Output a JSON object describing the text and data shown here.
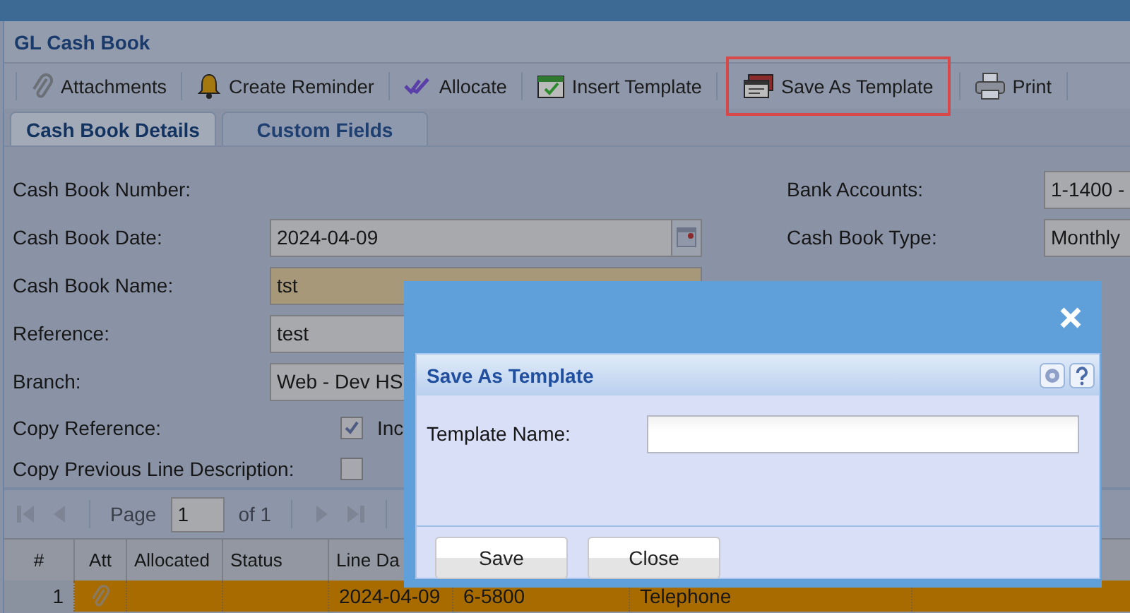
{
  "window": {
    "title": "GL Cash Book"
  },
  "toolbar": [
    {
      "kind": "attachments",
      "label": "Attachments",
      "highlighted": false
    },
    {
      "kind": "reminder",
      "label": "Create Reminder",
      "highlighted": false
    },
    {
      "kind": "allocate",
      "label": "Allocate",
      "highlighted": false
    },
    {
      "kind": "insert",
      "label": "Insert Template",
      "highlighted": false
    },
    {
      "kind": "save-template",
      "label": "Save As Template",
      "highlighted": true
    },
    {
      "kind": "print",
      "label": "Print",
      "highlighted": false
    }
  ],
  "tabs": [
    {
      "label": "Cash Book Details",
      "selected": true
    },
    {
      "label": "Custom Fields",
      "selected": false
    }
  ],
  "form_left": [
    {
      "kind": "label",
      "label": "Cash Book Number:"
    },
    {
      "kind": "date",
      "label": "Cash Book Date:",
      "value": "2024-04-09"
    },
    {
      "kind": "text",
      "label": "Cash Book Name:",
      "value": "tst",
      "required": true
    },
    {
      "kind": "text",
      "label": "Reference:",
      "value": "test",
      "required": false
    },
    {
      "kind": "text",
      "label": "Branch:",
      "value": "Web - Dev HS",
      "required": false
    },
    {
      "kind": "checkbox",
      "label": "Copy Reference:",
      "checked": true,
      "option": "Inc"
    },
    {
      "kind": "checkbox",
      "label": "Copy Previous Line Description:",
      "checked": false
    }
  ],
  "form_right": [
    {
      "label": "Bank Accounts:",
      "value": "1-1400 -"
    },
    {
      "label": "Cash Book Type:",
      "value": "Monthly"
    }
  ],
  "pager": {
    "page_label": "Page",
    "page": "1",
    "of": "of 1"
  },
  "grid": {
    "columns": [
      "#",
      "Att",
      "Allocated",
      "Status",
      "Line Da"
    ],
    "rows": [
      {
        "number": "1",
        "has_attachment": true,
        "line_date": "2024-04-09",
        "column_6": "6-5800",
        "column_7": "Telephone",
        "selected": true
      }
    ]
  },
  "dialog": {
    "title": "Save As Template",
    "field_label": "Template Name:",
    "buttons": [
      "Save",
      "Close"
    ]
  }
}
